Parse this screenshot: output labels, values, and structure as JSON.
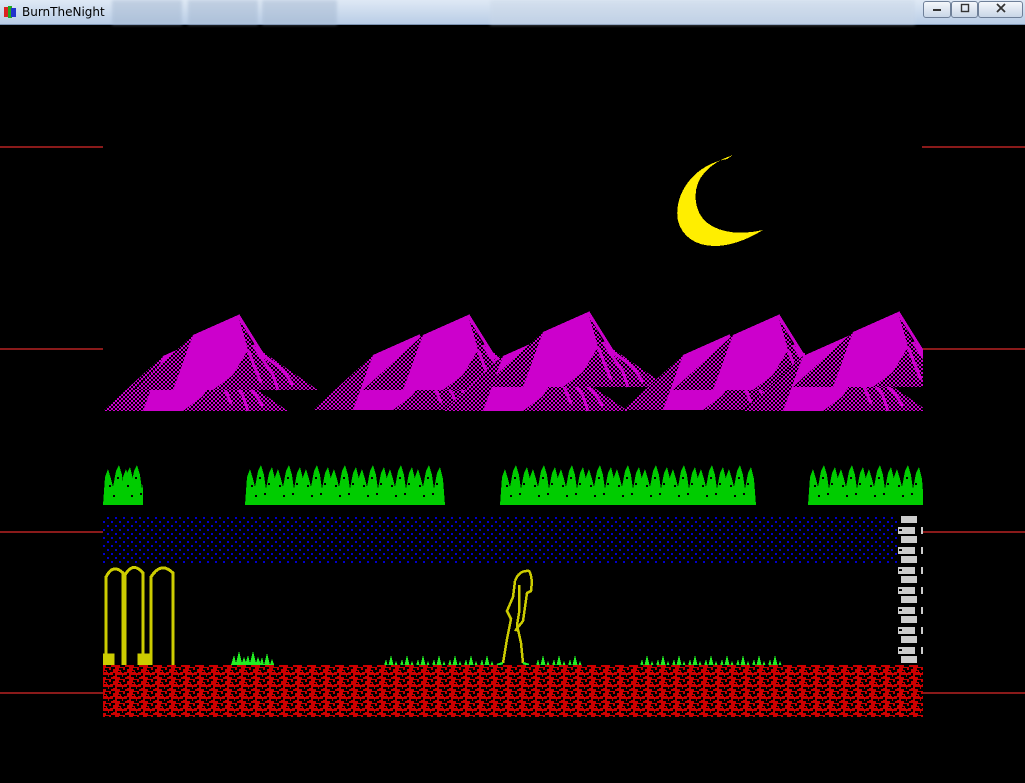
{
  "window": {
    "title": "BurnTheNight",
    "app_icon": "app-icon",
    "controls": {
      "minimize_icon": "minimize-icon",
      "maximize_icon": "maximize-icon",
      "close_icon": "close-icon"
    }
  },
  "scene": {
    "moon_color": "#ffee00",
    "mountain_color": "#cc00cc",
    "hedge_color": "#00cc00",
    "river_color": "#0000cc",
    "grass_color": "#22ee22",
    "ground_color": "#cc0000",
    "character_color": "#cccc00",
    "pillar_color": "#cccc00",
    "wall_color": "#cccccc",
    "border_marker_color": "#8a1a1a"
  }
}
